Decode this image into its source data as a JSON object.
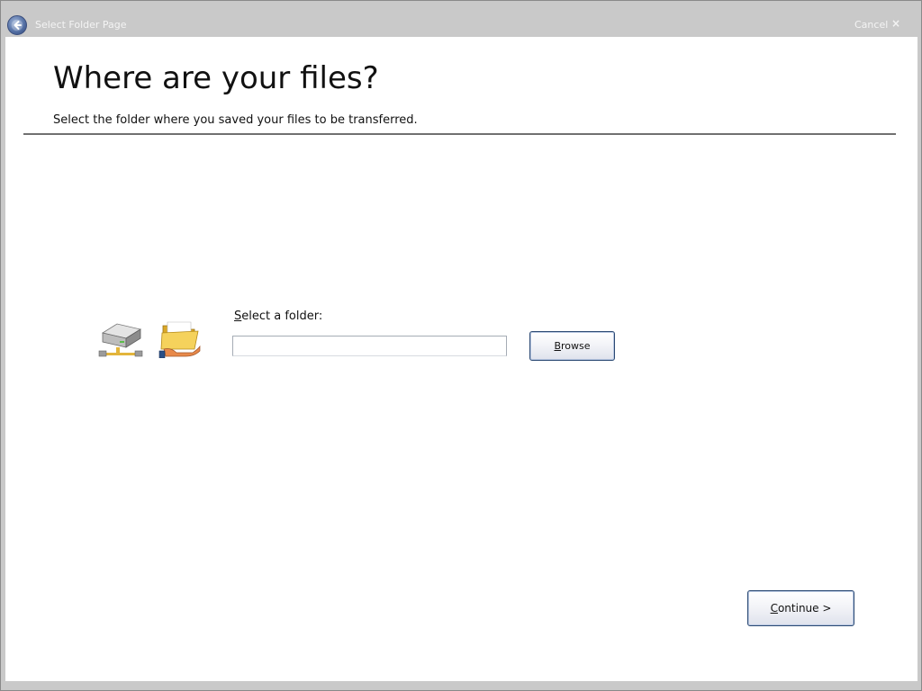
{
  "titlebar": {
    "page_title": "Select Folder Page",
    "cancel_label": "Cancel",
    "close_glyph": "×"
  },
  "main": {
    "heading": "Where are your files?",
    "subheading": "Select the folder where you saved your files to be transferred.",
    "field_label_mnemonic": "S",
    "field_label_rest": "elect a folder:",
    "folder_input": {
      "value": "",
      "placeholder": ""
    },
    "browse_mnemonic": "B",
    "browse_rest": "rowse"
  },
  "footer": {
    "continue_mnemonic": "C",
    "continue_rest": "ontinue >"
  },
  "icons": [
    "back-arrow-icon",
    "network-drive-icon",
    "shared-folder-icon",
    "close-icon"
  ],
  "colors": {
    "titlebar_bg": "#c9c9c9",
    "content_bg": "#ffffff",
    "button_border": "#2c4a74",
    "back_button": "#5672a6"
  }
}
